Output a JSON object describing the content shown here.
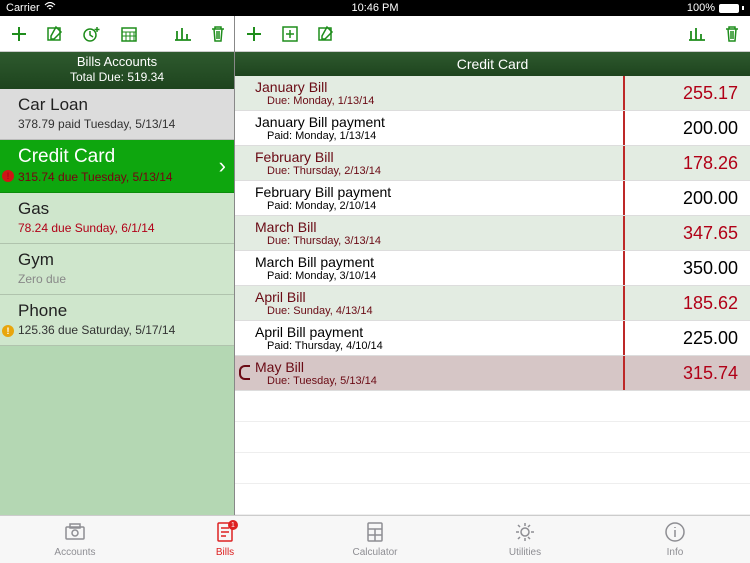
{
  "status": {
    "carrier": "Carrier",
    "time": "10:46 PM",
    "battery": "100%"
  },
  "left": {
    "header_title": "Bills Accounts",
    "header_sub": "Total Due: 519.34",
    "accounts": [
      {
        "name": "Car Loan",
        "sub": "378.79 paid Tuesday, 5/13/14",
        "style": "gray",
        "badge": null
      },
      {
        "name": "Credit Card",
        "sub": "315.74 due Tuesday, 5/13/14",
        "style": "sel",
        "badge": "red"
      },
      {
        "name": "Gas",
        "sub": "78.24 due Sunday, 6/1/14",
        "style": "light",
        "sub_red": true
      },
      {
        "name": "Gym",
        "sub": "Zero due",
        "style": "light",
        "sub_zero": true
      },
      {
        "name": "Phone",
        "sub": "125.36 due Saturday, 5/17/14",
        "style": "light",
        "badge": "yel"
      }
    ]
  },
  "right": {
    "header": "Credit Card",
    "transactions": [
      {
        "title": "January Bill",
        "sub": "Due: Monday, 1/13/14",
        "amt": "255.17",
        "kind": "bill"
      },
      {
        "title": "January Bill payment",
        "sub": "Paid: Monday, 1/13/14",
        "amt": "200.00",
        "kind": "pay"
      },
      {
        "title": "February Bill",
        "sub": "Due: Thursday, 2/13/14",
        "amt": "178.26",
        "kind": "bill"
      },
      {
        "title": "February Bill payment",
        "sub": "Paid: Monday, 2/10/14",
        "amt": "200.00",
        "kind": "pay"
      },
      {
        "title": "March Bill",
        "sub": "Due: Thursday, 3/13/14",
        "amt": "347.65",
        "kind": "bill"
      },
      {
        "title": "March Bill payment",
        "sub": "Paid: Monday, 3/10/14",
        "amt": "350.00",
        "kind": "pay"
      },
      {
        "title": "April Bill",
        "sub": "Due: Sunday, 4/13/14",
        "amt": "185.62",
        "kind": "bill"
      },
      {
        "title": "April Bill payment",
        "sub": "Paid: Thursday, 4/10/14",
        "amt": "225.00",
        "kind": "pay"
      },
      {
        "title": "May Bill",
        "sub": "Due: Tuesday, 5/13/14",
        "amt": "315.74",
        "kind": "curr"
      }
    ]
  },
  "tabs": {
    "items": [
      "Accounts",
      "Bills",
      "Calculator",
      "Utilities",
      "Info"
    ],
    "active": 1,
    "badge": "1"
  }
}
